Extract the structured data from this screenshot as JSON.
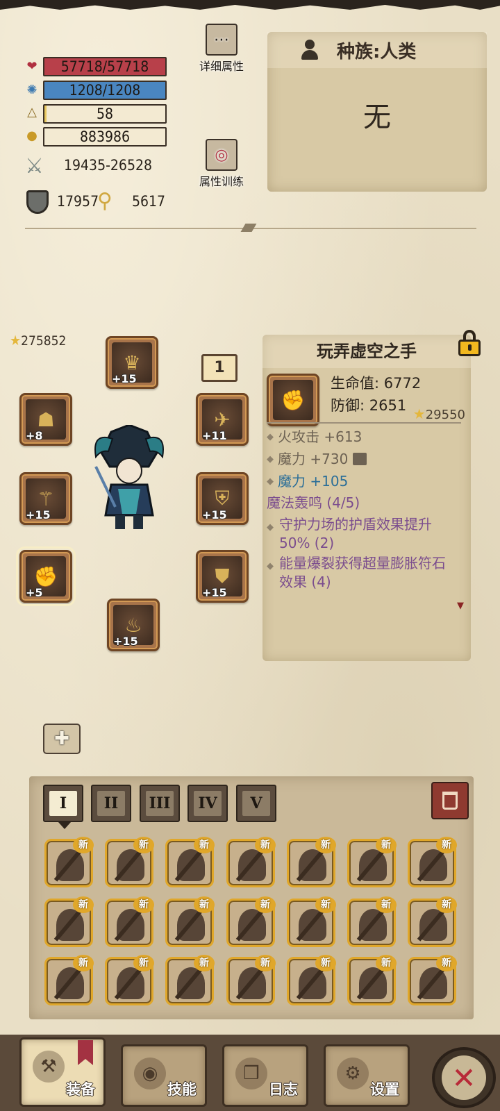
{
  "stats": {
    "hp": "57718/57718",
    "hp_fraction": 1.0,
    "mp": "1208/1208",
    "mp_fraction": 1.0,
    "level": "58",
    "level_fraction": 0.02,
    "gold": "883986",
    "attack": "19435-26528",
    "defense": "17957",
    "magic": "5617"
  },
  "buttons": {
    "detail_attr": "详细属性",
    "attr_training": "属性训练"
  },
  "race": {
    "label": "种族:人类",
    "value": "无"
  },
  "equipment": {
    "total_score": "275852",
    "slots": [
      {
        "name": "slot-head",
        "plus": "+15",
        "icon": "helmet-icon"
      },
      {
        "name": "slot-level-box",
        "plus": "1",
        "icon": "number-box"
      },
      {
        "name": "slot-amulet",
        "plus": "+8",
        "icon": "beast-head-icon"
      },
      {
        "name": "slot-wings",
        "plus": "+11",
        "icon": "wings-icon"
      },
      {
        "name": "slot-weapon",
        "plus": "+15",
        "icon": "staff-icon"
      },
      {
        "name": "slot-shoulder",
        "plus": "+15",
        "icon": "shoulder-icon"
      },
      {
        "name": "slot-gloves",
        "plus": "+5",
        "icon": "gauntlet-icon"
      },
      {
        "name": "slot-armor",
        "plus": "+15",
        "icon": "armor-icon"
      },
      {
        "name": "slot-boots",
        "plus": "+15",
        "icon": "boots-icon"
      }
    ]
  },
  "item": {
    "name": "玩弄虚空之手",
    "hp": "生命值: 6772",
    "def": "防御: 2651",
    "score": "29550",
    "affixes": [
      {
        "text": "火攻击 +613",
        "color": "gray"
      },
      {
        "text": "魔力 +730",
        "color": "gray"
      },
      {
        "text": "魔力 +105",
        "color": "blue"
      }
    ],
    "set_name": "魔法轰鸣 (4/5)",
    "set_bonuses": [
      "守护力场的护盾效果提升 50% (2)",
      "能量爆裂获得超量膨胀符石 效果 (4)"
    ]
  },
  "inventory": {
    "tabs": [
      "I",
      "II",
      "III",
      "IV",
      "V"
    ],
    "active_tab": 0,
    "new_label": "新"
  },
  "nav": {
    "equip": "装备",
    "skill": "技能",
    "log": "日志",
    "settings": "设置"
  },
  "colors": {
    "hp_bar": "#b8404a",
    "mp_bar": "#4a86c0",
    "level_bar": "#e8c860",
    "affix_blue": "#2b6e98",
    "affix_purple": "#7b4d8e",
    "close_red": "#b82a38"
  }
}
